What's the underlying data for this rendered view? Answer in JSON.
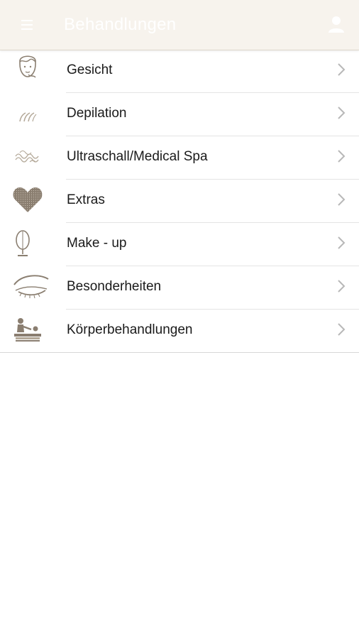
{
  "header": {
    "title": "Behandlungen"
  },
  "list": {
    "items": [
      {
        "label": "Gesicht",
        "icon": "face-mask-icon"
      },
      {
        "label": "Depilation",
        "icon": "hair-icon"
      },
      {
        "label": "Ultraschall/Medical Spa",
        "icon": "wave-icon"
      },
      {
        "label": "Extras",
        "icon": "heart-icon"
      },
      {
        "label": "Make - up",
        "icon": "mirror-icon"
      },
      {
        "label": "Besonderheiten",
        "icon": "eyelash-icon"
      },
      {
        "label": "Körperbehandlungen",
        "icon": "massage-icon"
      }
    ]
  },
  "colors": {
    "header_bg": "#f7f3ed",
    "icon": "#8a7e70",
    "chevron": "#b8b8b8",
    "text": "#1a1a1a"
  }
}
